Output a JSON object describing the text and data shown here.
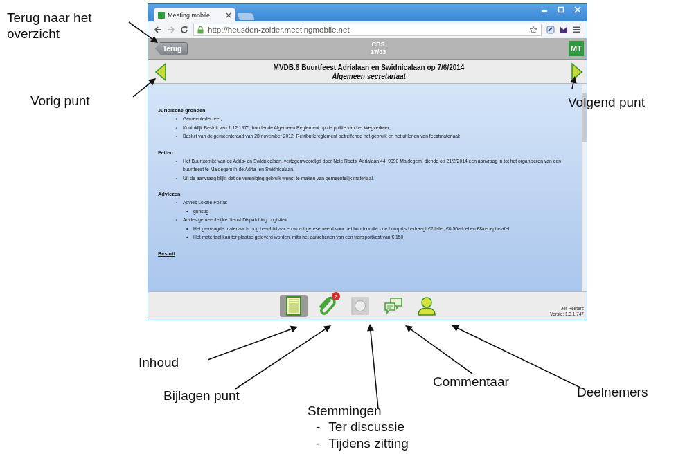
{
  "browser": {
    "tab_title": "Meeting.mobile",
    "url": "http://heusden-zolder.meetingmobile.net"
  },
  "app_header": {
    "back_button": "Terug",
    "meeting": "CBS",
    "date": "17/03",
    "logo": "MT"
  },
  "agenda_item": {
    "title": "MVDB.6 Buurtfeest Adrialaan en Swidnicalaan op 7/6/2014",
    "department": "Algemeen secretariaat"
  },
  "sections": [
    {
      "heading": "Juridische gronden",
      "underlined": false,
      "items": [
        {
          "bullet": "•",
          "text": "Gemeentedecreet;"
        },
        {
          "bullet": "•",
          "text": "Koninklijk Besluit van 1.12.1975, houdende Algemeen Reglement op de politie van het Wegverkeer;"
        },
        {
          "bullet": "•",
          "text": "Besluit van de gemeenteraad van 28 november 2012: Retributiereglement betreffende het gebruik en het uitlenen van feestmateriaal;"
        }
      ]
    },
    {
      "heading": "Feiten",
      "underlined": false,
      "items": [
        {
          "bullet": "•",
          "text": "Het Buurtcomité van de Adria- en Swidnicalaan, vertegenwoordigd door Nele Roets, Adrialaan 44, 9990 Maldegem, diende op 21/2/2014 een aanvraag in tot het organiseren van een buurtfeest te Maldegem in de Adria- en Swidnicalaan."
        },
        {
          "bullet": "•",
          "text": "Uit de aanvraag blijkt dat de vereniging gebruik wenst te maken van gemeentelijk materiaal."
        }
      ]
    },
    {
      "heading": "Adviezen",
      "underlined": false,
      "items": [
        {
          "bullet": "•",
          "text": "Advies Lokale Politie:",
          "children": [
            {
              "bullet": "•",
              "text": "gunstig"
            }
          ]
        },
        {
          "bullet": "•",
          "text": "Advies gemeentelijke dienst Dispatching Logistiek:",
          "children": [
            {
              "bullet": "•",
              "text": "Het gevraagde materiaal is nog beschikbaar en wordt gereserveerd voor het buurtcomité - de huurprijs bedraagt €2/tafel, €0,50/stoel en €8/receptietafel"
            },
            {
              "bullet": "•",
              "text": "Het materiaal kan ter plaatse geleverd worden, mits het aanrekenen van een transportkost van € 150."
            }
          ]
        }
      ]
    },
    {
      "heading": "Besluit",
      "underlined": true
    }
  ],
  "toolbar": [
    {
      "kind": "content",
      "selected": true
    },
    {
      "kind": "attachments",
      "selected": false,
      "badge": "2"
    },
    {
      "kind": "votes",
      "selected": false
    },
    {
      "kind": "comments",
      "selected": false
    },
    {
      "kind": "participants",
      "selected": false
    }
  ],
  "footer": {
    "user": "Jef Peeters",
    "version": "Versie: 1.3.1.747"
  },
  "annotations": [
    {
      "text": "Terug naar het overzicht"
    },
    {
      "text": "Vorig punt"
    },
    {
      "text": "Volgend punt"
    },
    {
      "text": "Inhoud"
    },
    {
      "text": "Bijlagen punt"
    },
    {
      "text": "Stemmingen",
      "children": [
        {
          "bullet": "-",
          "text": "Ter discussie"
        },
        {
          "bullet": "-",
          "text": "Tijdens zitting"
        }
      ]
    },
    {
      "text": "Commentaar"
    },
    {
      "text": "Deelnemers"
    }
  ]
}
